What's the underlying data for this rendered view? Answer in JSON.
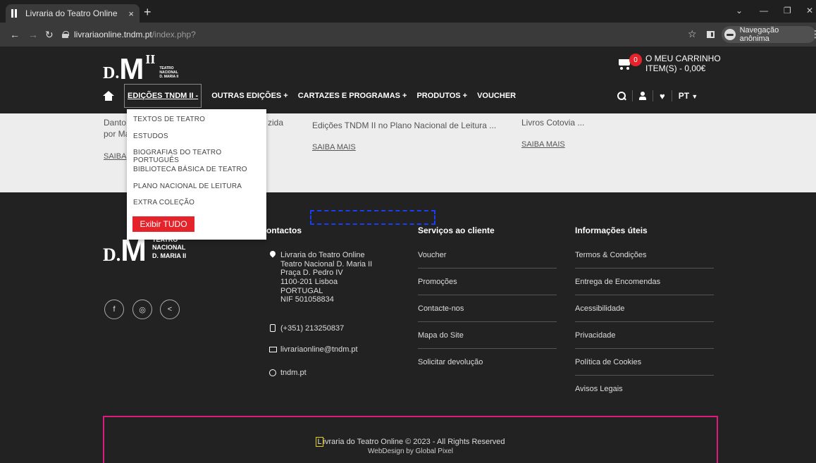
{
  "browser": {
    "tab_title": "Livraria do Teatro Online",
    "tab_close": "×",
    "new_tab": "+",
    "url_host": "livrariaonline.tndm.pt",
    "url_path": "/index.php?",
    "incognito_label": "Navegação anônima",
    "controls": {
      "minimize": "—",
      "restore": "❐",
      "close": "✕",
      "dropdown": "⌄"
    }
  },
  "header": {
    "logo": {
      "d": "D.",
      "m": "M",
      "ii": "II",
      "lines": [
        "TEATRO",
        "NACIONAL",
        "D. MARIA II"
      ]
    },
    "cart": {
      "count": "0",
      "line1": "O MEU CARRINHO",
      "line2": "ITEM(S) - 0,00€"
    },
    "nav": [
      {
        "label": "EDIÇÕES TNDM II -"
      },
      {
        "label": "OUTRAS EDIÇÕES +"
      },
      {
        "label": "CARTAZES E PROGRAMAS +"
      },
      {
        "label": "PRODUTOS +"
      },
      {
        "label": "VOUCHER"
      }
    ],
    "language": "PT"
  },
  "dropdown": {
    "items": [
      "TEXTOS DE TEATRO",
      "ESTUDOS",
      "BIOGRAFIAS DO TEATRO PORTUGUÊS",
      "BIBLIOTECA BÁSICA DE TEATRO",
      "PLANO NACIONAL DE LEITURA",
      "EXTRA COLEÇÃO"
    ],
    "button": "Exibir TUDO"
  },
  "content": {
    "card1_line1": "Danto",
    "card1_line2": "por Ma",
    "card1_frag": "zida",
    "card1_link": "SAIBA",
    "card2_text": "Edições TNDM II no Plano Nacional de Leitura ...",
    "card2_link": "SAIBA MAIS",
    "card3_text": "Livros Cotovia ...",
    "card3_link": "SAIBA MAIS"
  },
  "footer": {
    "logo": {
      "d": "D.",
      "m": "M",
      "lines": [
        "TEATRO",
        "NACIONAL",
        "D. MARIA II"
      ]
    },
    "social": [
      "f",
      "◎",
      "<"
    ],
    "contacts": {
      "title": "ontactos",
      "address": [
        "Livraria do Teatro Online",
        "Teatro Nacional D. Maria II",
        "Praça D. Pedro IV",
        "1100-201 Lisboa",
        "PORTUGAL",
        "NIF 501058834"
      ],
      "phone": "(+351) 213250837",
      "email": "livrariaonline@tndm.pt",
      "site": "tndm.pt"
    },
    "services": {
      "title": "Serviços ao cliente",
      "links": [
        "Voucher",
        "Promoções",
        "Contacte-nos",
        "Mapa do Site",
        "Solicitar devolução"
      ]
    },
    "info": {
      "title": "Informações úteis",
      "links": [
        "Termos & Condições",
        "Entrega de Encomendas",
        "Acessibilidade",
        "Privacidade",
        "Política de Cookies",
        "Avisos Legais"
      ]
    },
    "copyright_first": "L",
    "copyright_rest": "ivraria do Teatro Online © 2023 - All Rights Reserved",
    "webdesign": "WebDesign by Global Pixel"
  }
}
